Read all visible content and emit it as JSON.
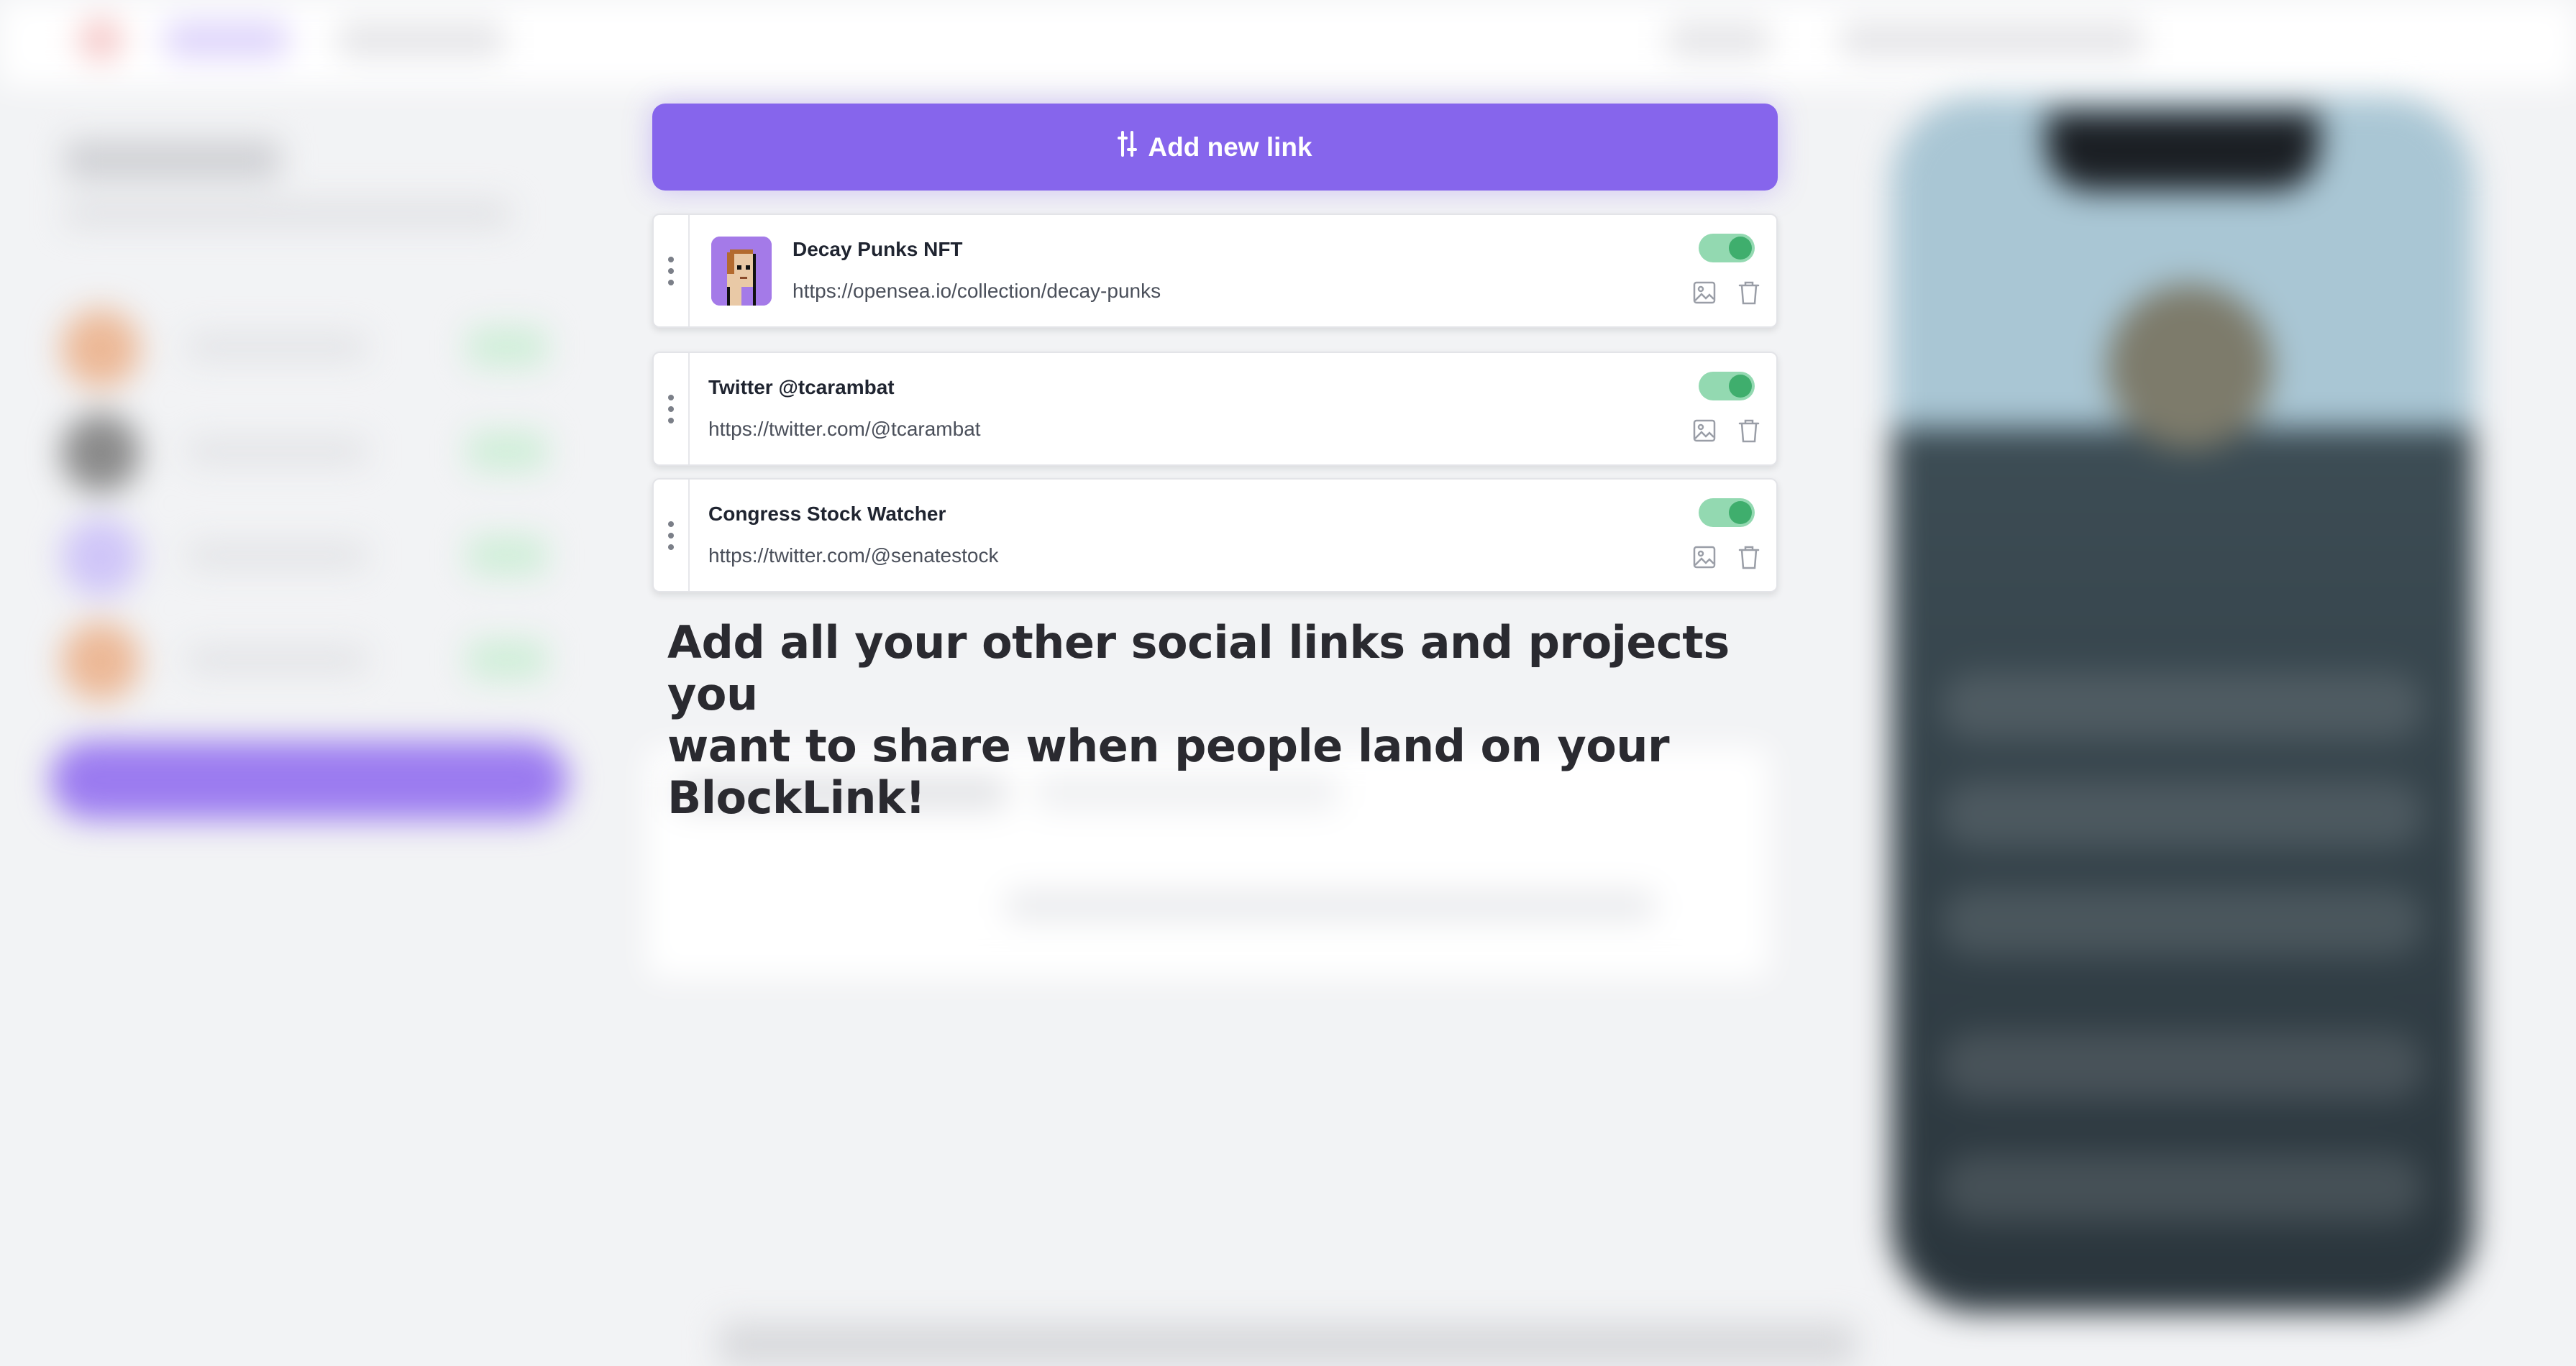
{
  "add_link": {
    "label": "Add new link",
    "icon": "sliders-icon"
  },
  "links": [
    {
      "title": "Decay Punks NFT",
      "url": "https://opensea.io/collection/decay-punks",
      "has_thumbnail": true,
      "enabled": true
    },
    {
      "title": "Twitter @tcarambat",
      "url": "https://twitter.com/@tcarambat",
      "has_thumbnail": false,
      "enabled": true
    },
    {
      "title": "Congress Stock Watcher",
      "url": "https://twitter.com/@senatestock",
      "has_thumbnail": false,
      "enabled": true
    }
  ],
  "caption": {
    "line1": "Add all your other social links and projects you",
    "line2": "want to share when people land on your BlockLink!"
  },
  "colors": {
    "accent": "#8665ec",
    "toggle_on_track": "#93d9b1",
    "toggle_on_knob": "#3fae6d",
    "background": "#f2f3f5"
  },
  "icons": {
    "drag": "drag-handle-icon",
    "image": "image-icon",
    "trash": "trash-icon"
  }
}
